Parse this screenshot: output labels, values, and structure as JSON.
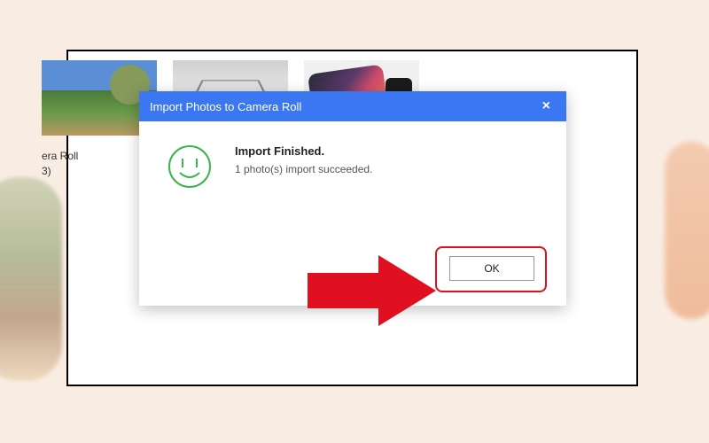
{
  "folder": {
    "name": "era Roll",
    "count": "3)"
  },
  "dialog": {
    "title": "Import Photos to Camera Roll",
    "message_title": "Import Finished.",
    "message_sub": "1 photo(s) import succeeded.",
    "ok_label": "OK",
    "close_label": "×"
  },
  "colors": {
    "titlebar": "#3a77f0",
    "highlight": "#e01020"
  }
}
